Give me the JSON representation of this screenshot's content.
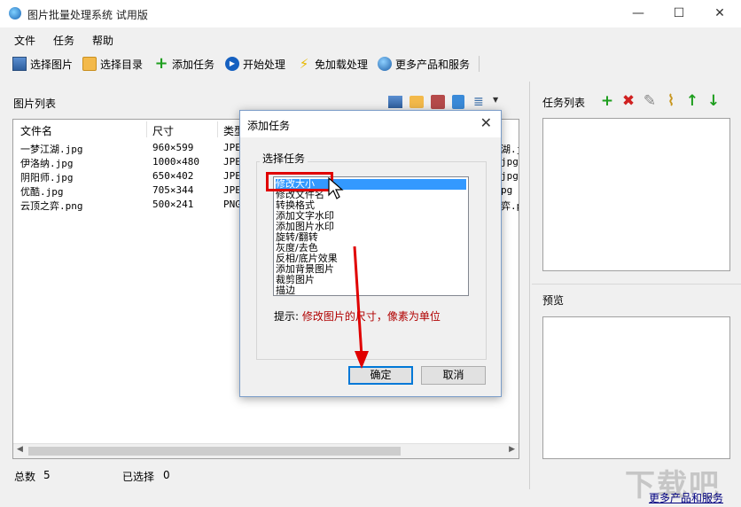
{
  "window": {
    "title": "图片批量处理系统 试用版",
    "minimize": "—",
    "maximize": "☐",
    "close": "✕"
  },
  "menu": {
    "file": "文件",
    "task": "任务",
    "help": "帮助"
  },
  "toolbar": {
    "select_image": "选择图片",
    "select_dir": "选择目录",
    "add_task": "添加任务",
    "start": "开始处理",
    "free_install": "免加载处理",
    "more_products": "更多产品和服务"
  },
  "image_list": {
    "title": "图片列表",
    "columns": [
      "文件名",
      "尺寸",
      "类型"
    ],
    "rows": [
      {
        "name": "一梦江湖.jpg",
        "size": "960×599",
        "type": "JPE",
        "tail": "湖.j"
      },
      {
        "name": "伊洛纳.jpg",
        "size": "1000×480",
        "type": "JPE",
        "tail": "jpg"
      },
      {
        "name": "阴阳师.jpg",
        "size": "650×402",
        "type": "JPE",
        "tail": "jpg"
      },
      {
        "name": "优酷.jpg",
        "size": "705×344",
        "type": "JPE",
        "tail": "pg"
      },
      {
        "name": "云顶之弈.png",
        "size": "500×241",
        "type": "PNG",
        "tail": "弈.p"
      }
    ]
  },
  "status": {
    "total_label": "总数",
    "total": "5",
    "selected_label": "已选择",
    "selected": "0"
  },
  "task_panel": {
    "title": "任务列表"
  },
  "preview_panel": {
    "title": "预览"
  },
  "more_link": "更多产品和服务",
  "watermark": "下载吧",
  "dialog": {
    "title": "添加任务",
    "close": "✕",
    "group_label": "选择任务",
    "options": [
      "修改大小",
      "修改文件名",
      "转换格式",
      "添加文字水印",
      "添加图片水印",
      "旋转/翻转",
      "灰度/去色",
      "反相/底片效果",
      "添加背景图片",
      "裁剪图片",
      "描边"
    ],
    "selected_index": 0,
    "hint_label": "提示:",
    "hint_value": "修改图片的尺寸，像素为单位",
    "ok": "确定",
    "cancel": "取消"
  },
  "colors": {
    "selection": "#3399ff",
    "annotation": "#e00000",
    "hint": "#b00000"
  }
}
